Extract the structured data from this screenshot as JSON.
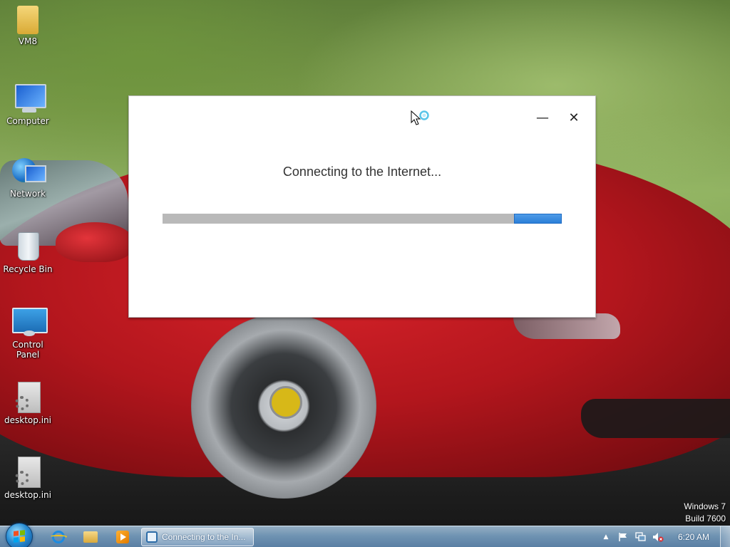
{
  "desktop": {
    "icons": [
      {
        "label": "VM8",
        "icon": "user-folder-icon"
      },
      {
        "label": "Computer",
        "icon": "computer-icon"
      },
      {
        "label": "Network",
        "icon": "network-icon"
      },
      {
        "label": "Recycle Bin",
        "icon": "recycle-bin-icon"
      },
      {
        "label": "Control Panel",
        "icon": "control-panel-icon"
      },
      {
        "label": "desktop.ini",
        "icon": "settings-file-icon"
      },
      {
        "label": "desktop.ini",
        "icon": "settings-file-icon"
      }
    ],
    "watermark": {
      "line1": "Windows 7",
      "line2": "Build 7600"
    }
  },
  "dialog": {
    "message": "Connecting to the Internet...",
    "minimize_glyph": "—",
    "close_glyph": "✕",
    "progress": {
      "type": "indeterminate",
      "segment_start": 0.88,
      "segment_end": 1.0,
      "color": "#2b7fd8",
      "track_color": "#b9b9b9"
    }
  },
  "taskbar": {
    "pinned": [
      {
        "name": "internet-explorer",
        "icon": "internet-explorer-icon"
      },
      {
        "name": "windows-explorer",
        "icon": "folder-icon"
      },
      {
        "name": "media-player",
        "icon": "media-player-icon"
      }
    ],
    "active_task": {
      "label": "Connecting to the In..."
    },
    "tray": {
      "show_hidden": "▲",
      "icons": [
        "action-center-flag-icon",
        "network-disconnected-icon",
        "volume-muted-icon"
      ]
    },
    "clock": "6:20 AM"
  }
}
